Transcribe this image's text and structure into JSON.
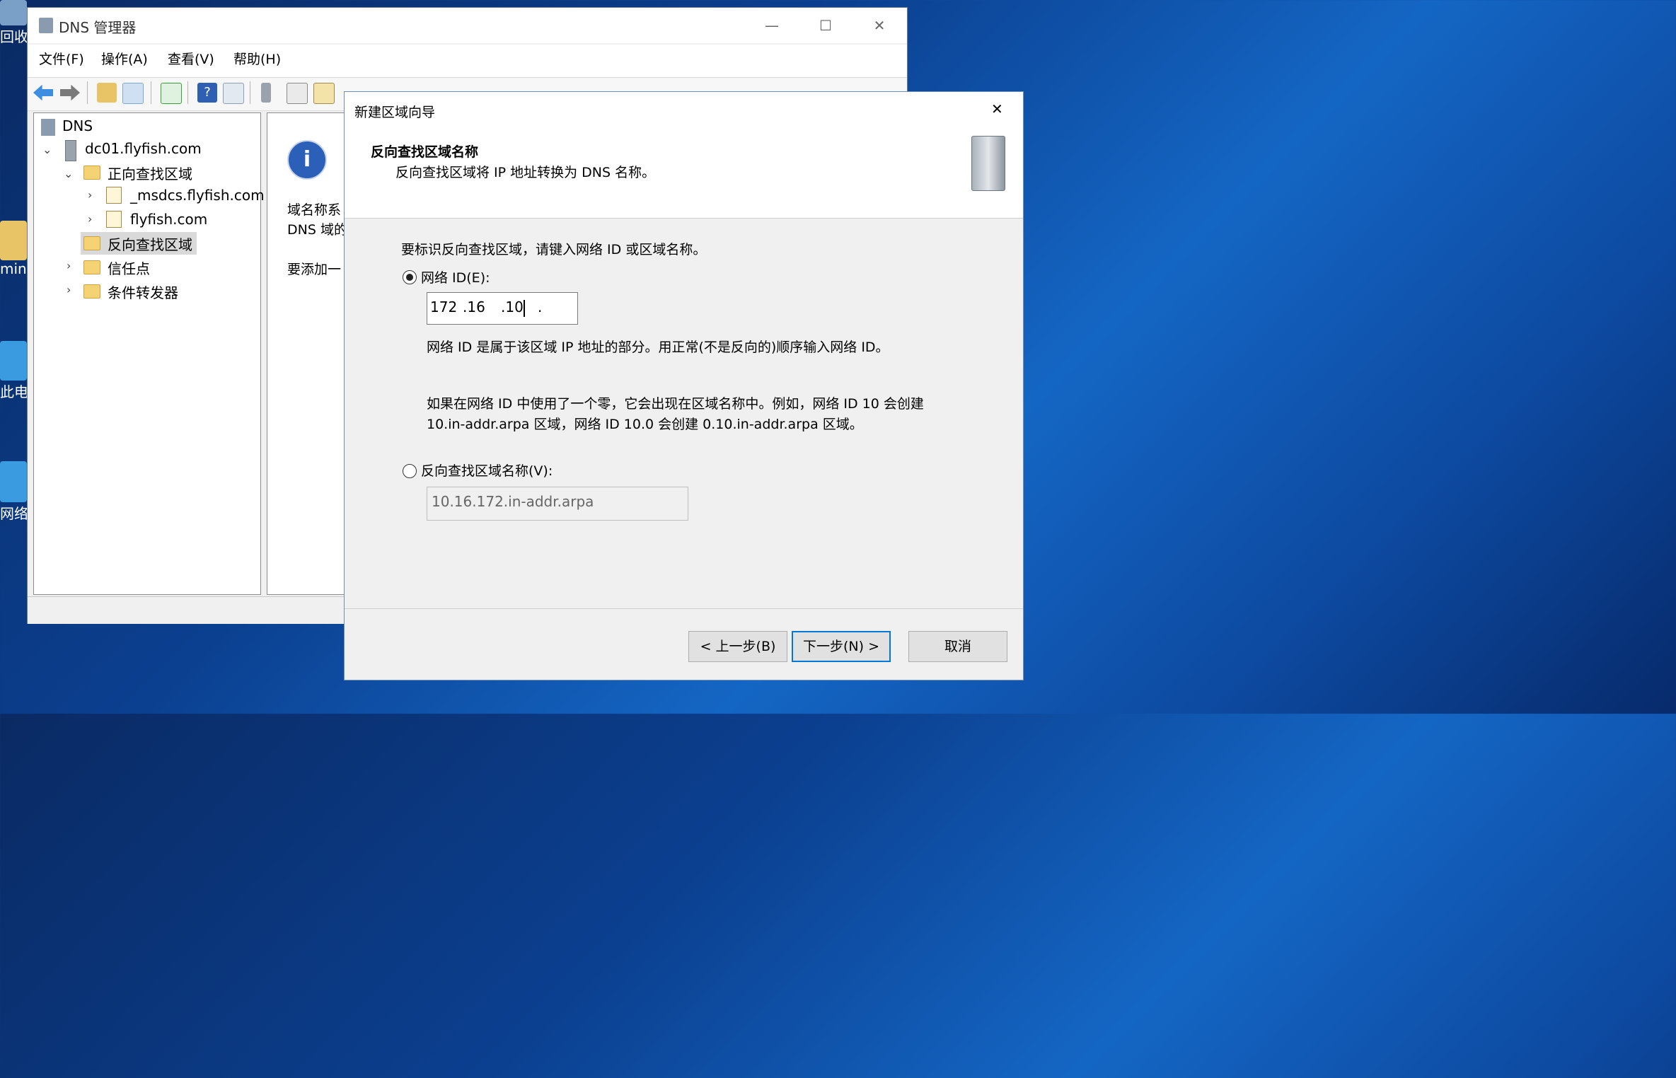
{
  "desktop": {
    "icons": [
      "回收",
      "min",
      "此电",
      "网络"
    ]
  },
  "main_window": {
    "title": "DNS 管理器",
    "controls": {
      "minimize": "—",
      "maximize": "☐",
      "close": "✕"
    },
    "menu": [
      "文件(F)",
      "操作(A)",
      "查看(V)",
      "帮助(H)"
    ],
    "tree": {
      "root": "DNS",
      "server": "dc01.flyfish.com",
      "forward": "正向查找区域",
      "zone1": "_msdcs.flyfish.com",
      "zone2": "flyfish.com",
      "reverse": "反向查找区域",
      "trust": "信任点",
      "conditional": "条件转发器"
    },
    "right_pane": {
      "line1": "域名称系",
      "line2": "DNS 域的",
      "line3": "要添加一"
    }
  },
  "dialog": {
    "title": "新建区域向导",
    "close": "✕",
    "header_title": "反向查找区域名称",
    "header_subtitle": "反向查找区域将 IP 地址转换为 DNS 名称。",
    "instruction": "要标识反向查找区域，请键入网络 ID 或区域名称。",
    "option_network_id": "网络 ID(E):",
    "network_id_selected": true,
    "ip_segments": [
      "172",
      ".16",
      ".10",
      "."
    ],
    "note1": "网络 ID 是属于该区域 IP 地址的部分。用正常(不是反向的)顺序输入网络 ID。",
    "note2_line1": "如果在网络 ID 中使用了一个零，它会出现在区域名称中。例如，网络 ID 10 会创建",
    "note2_line2": "10.in-addr.arpa 区域，网络 ID 10.0 会创建 0.10.in-addr.arpa 区域。",
    "option_zone_name": "反向查找区域名称(V):",
    "zone_name_value": "10.16.172.in-addr.arpa",
    "buttons": {
      "back": "< 上一步(B)",
      "next": "下一步(N) >",
      "cancel": "取消"
    }
  }
}
